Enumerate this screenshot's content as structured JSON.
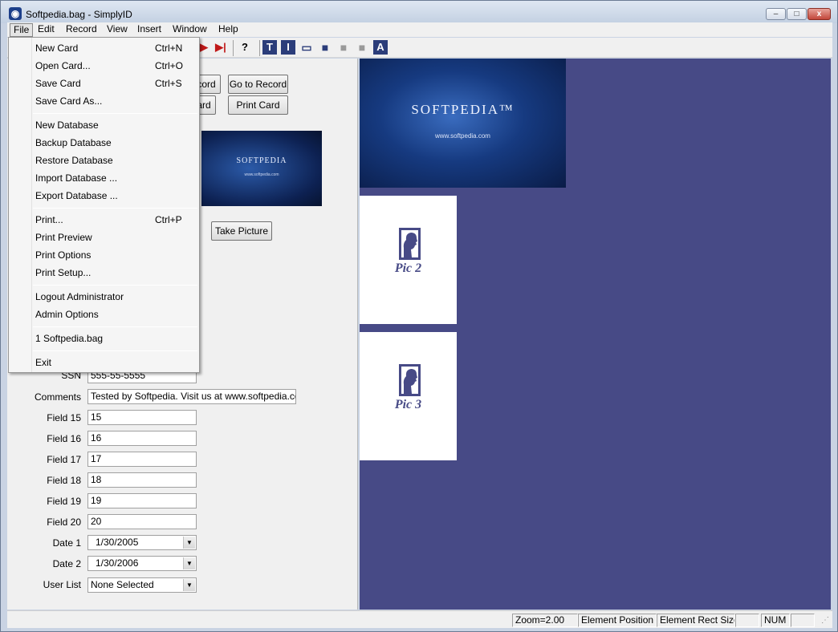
{
  "window": {
    "title": "Softpedia.bag - SimplyID",
    "minimize": "–",
    "maximize": "□",
    "close": "x"
  },
  "menubar": [
    "File",
    "Edit",
    "Record",
    "View",
    "Insert",
    "Window",
    "Help"
  ],
  "toolbar": {
    "help_glyph": "?",
    "text_tools": [
      "T",
      "I",
      "▭",
      "■",
      "■",
      "■",
      "A"
    ]
  },
  "form": {
    "buttons": {
      "prev_record_partial": "cord",
      "go_to_record": "Go to Record",
      "card_partial": "ard",
      "print_card": "Print Card",
      "take_picture": "Take Picture"
    },
    "card_thumb": {
      "logo": "SOFTPEDIA",
      "url": "www.softpedia.com"
    },
    "fields": [
      {
        "label": "SSN",
        "value": "555-55-5555"
      },
      {
        "label": "Comments",
        "value": "Tested by Softpedia. Visit us at www.softpedia.com"
      },
      {
        "label": "Field 15",
        "value": "15"
      },
      {
        "label": "Field 16",
        "value": "16"
      },
      {
        "label": "Field 17",
        "value": "17"
      },
      {
        "label": "Field 18",
        "value": "18"
      },
      {
        "label": "Field 19",
        "value": "19"
      },
      {
        "label": "Field 20",
        "value": "20"
      }
    ],
    "combos": [
      {
        "label": "Date 1",
        "value": "1/30/2005"
      },
      {
        "label": "Date 2",
        "value": "1/30/2006"
      },
      {
        "label": "User List",
        "value": "None Selected"
      }
    ]
  },
  "canvas": {
    "card": {
      "logo": "SOFTPEDIA™",
      "url": "www.softpedia.com"
    },
    "pics": [
      "Pic 2",
      "Pic 3"
    ],
    "colors": {
      "background": "#474a86",
      "card_dark": "#0a1c47"
    }
  },
  "file_menu": {
    "items": [
      {
        "label": "New Card",
        "shortcut": "Ctrl+N"
      },
      {
        "label": "Open Card...",
        "shortcut": "Ctrl+O"
      },
      {
        "label": "Save Card",
        "shortcut": "Ctrl+S"
      },
      {
        "label": "Save Card As...",
        "shortcut": ""
      },
      {
        "label": "New Database",
        "shortcut": ""
      },
      {
        "label": "Backup Database",
        "shortcut": ""
      },
      {
        "label": "Restore Database",
        "shortcut": ""
      },
      {
        "label": "Import Database ...",
        "shortcut": ""
      },
      {
        "label": "Export Database ...",
        "shortcut": ""
      },
      {
        "label": "Print...",
        "shortcut": "Ctrl+P"
      },
      {
        "label": "Print Preview",
        "shortcut": ""
      },
      {
        "label": "Print Options",
        "shortcut": ""
      },
      {
        "label": "Print Setup...",
        "shortcut": ""
      },
      {
        "label": "Logout Administrator",
        "shortcut": ""
      },
      {
        "label": "Admin Options",
        "shortcut": ""
      },
      {
        "label": "1 Softpedia.bag",
        "shortcut": ""
      },
      {
        "label": "Exit",
        "shortcut": ""
      }
    ]
  },
  "statusbar": {
    "zoom": "Zoom=2.00",
    "element_position": "Element Position",
    "element_rect_size": "Element Rect Size",
    "num": "NUM"
  }
}
